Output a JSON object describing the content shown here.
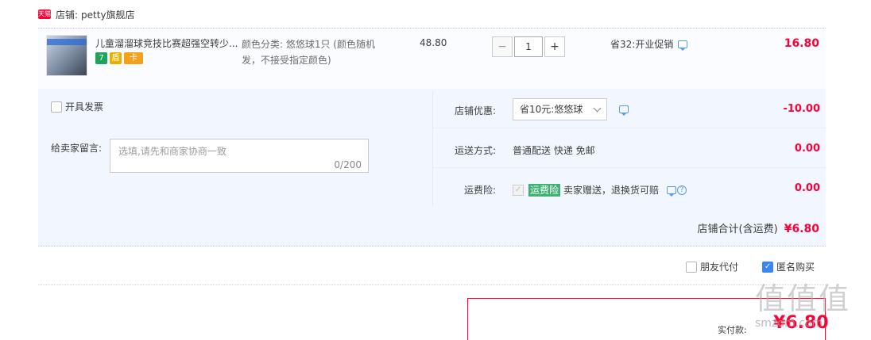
{
  "shop": {
    "tmall_badge": "天猫",
    "prefix": "店铺:",
    "name": "petty旗舰店"
  },
  "item": {
    "title": "儿童溜溜球竞技比赛超强空转少...",
    "sku": "颜色分类: 悠悠球1只 (颜色随机发，不接受指定颜色)",
    "unit_price": "48.80",
    "quantity": "1",
    "qty_minus": "−",
    "qty_plus": "+",
    "promo": "省32:开业促销",
    "total": "16.80",
    "badges": [
      "7",
      "盾",
      "卡"
    ]
  },
  "invoice": {
    "label": "开具发票"
  },
  "message": {
    "label": "给卖家留言:",
    "placeholder": "选填,请先和商家协商一致",
    "counter": "0/200"
  },
  "shop_discount": {
    "label": "店铺优惠:",
    "selected": "省10元:悠悠球",
    "amount": "-10.00"
  },
  "shipping": {
    "label": "运送方式:",
    "value": "普通配送 快递 免邮",
    "amount": "0.00"
  },
  "insurance": {
    "label": "运费险:",
    "badge": "运费险",
    "value": "卖家赠送，退换货可赔",
    "amount": "0.00"
  },
  "shop_total": {
    "label": "店铺合计(含运费)",
    "value": "¥6.80"
  },
  "options": {
    "friend_pay": "朋友代付",
    "anonymous": "匿名购买"
  },
  "payment": {
    "label": "实付款:",
    "value": "¥6.80"
  },
  "watermark": {
    "main": "值值值",
    "sub": "smzdm.com"
  },
  "colors": {
    "accent": "#ff0036",
    "panel": "#f2f7ff",
    "link": "#3b85f5"
  }
}
